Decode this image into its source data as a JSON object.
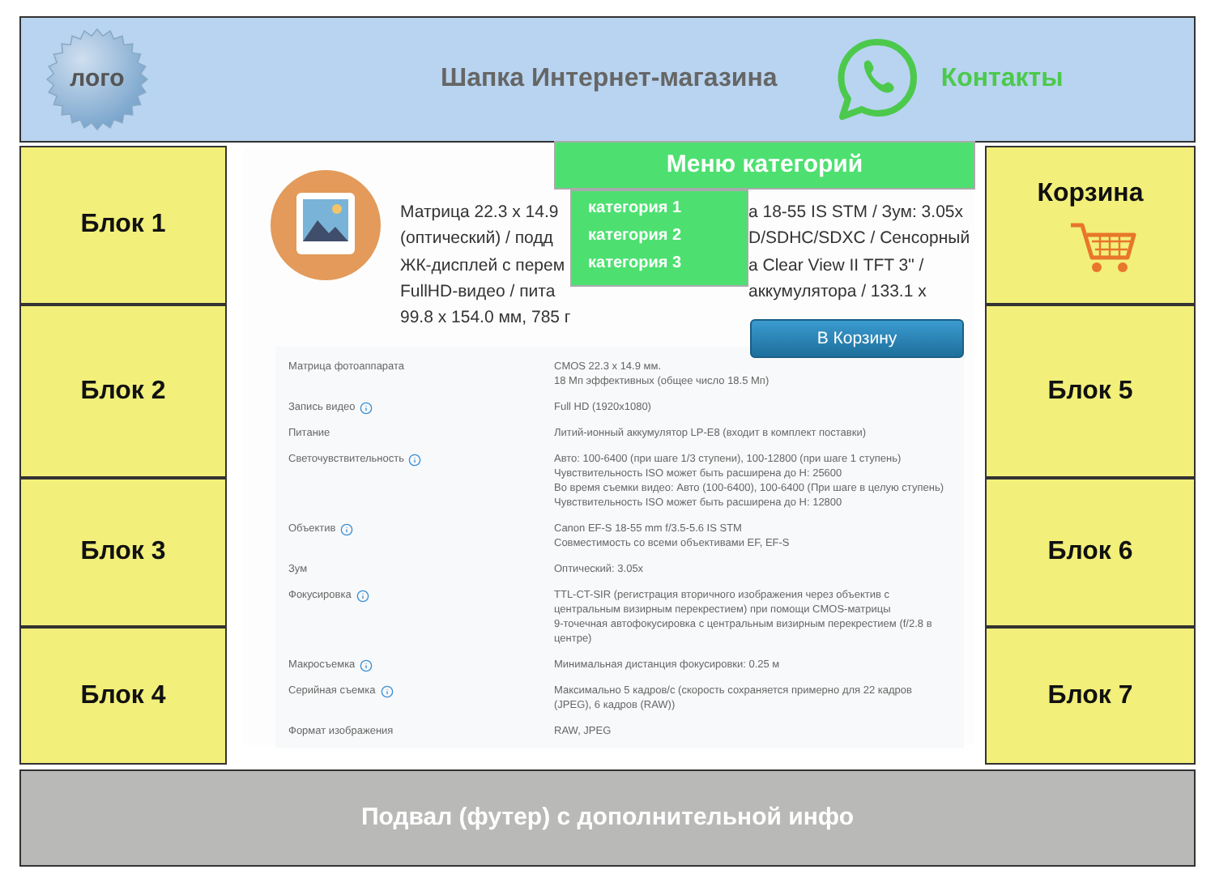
{
  "header": {
    "logo": "лого",
    "title": "Шапка Интернет-магазина",
    "contacts": "Контакты"
  },
  "left_blocks": [
    "Блок 1",
    "Блок 2",
    "Блок 3",
    "Блок 4"
  ],
  "right_blocks": [
    {
      "kind": "cart",
      "label": "Корзина"
    },
    {
      "kind": "plain",
      "label": "Блок 5"
    },
    {
      "kind": "plain",
      "label": "Блок 6"
    },
    {
      "kind": "plain",
      "label": "Блок 7"
    }
  ],
  "menu": {
    "title": "Меню категорий",
    "items": [
      "категория 1",
      "категория 2",
      "категория 3"
    ]
  },
  "product": {
    "description_left": [
      "Матрица 22.3 x 14.9",
      "(оптический) / подд",
      "ЖК-дисплей с перем",
      "FullHD-видео / пита",
      "99.8 x 154.0 мм, 785 г"
    ],
    "description_right": [
      "а 18-55 IS STM / Зум: 3.05x",
      "D/SDHC/SDXC / Сенсорный",
      "a Clear View II TFT 3\" /",
      "аккумулятора / 133.1 x"
    ],
    "button": "В Корзину",
    "specs": [
      {
        "name": "Матрица фотоаппарата",
        "info": false,
        "value": [
          "CMOS 22.3 x 14.9 мм.",
          "18 Мп эффективных (общее число 18.5 Мп)"
        ]
      },
      {
        "name": "Запись видео",
        "info": true,
        "value": [
          "Full HD (1920x1080)"
        ]
      },
      {
        "name": "Питание",
        "info": false,
        "value": [
          "Литий-ионный аккумулятор LP-E8 (входит в комплект поставки)"
        ]
      },
      {
        "name": "Светочувствительность",
        "info": true,
        "value": [
          "Авто: 100-6400 (при шаге 1/3 ступени), 100-12800 (при шаге 1 ступень)",
          "Чувствительность ISO может быть расширена до H: 25600",
          "Во время съемки видео: Авто (100-6400), 100-6400 (При шаге в целую ступень)",
          "Чувствительность ISO может быть расширена до H: 12800"
        ]
      },
      {
        "name": "Объектив",
        "info": true,
        "value": [
          "Canon EF-S 18-55 mm f/3.5-5.6 IS STM",
          "Совместимость со всеми объективами EF, EF-S"
        ]
      },
      {
        "name": "Зум",
        "info": false,
        "value": [
          "Оптический: 3.05x"
        ]
      },
      {
        "name": "Фокусировка",
        "info": true,
        "value": [
          "TTL-CT-SIR (регистрация вторичного изображения через объектив с центральным визирным перекрестием) при помощи CMOS-матрицы",
          "9-точечная автофокусировка с центральным визирным перекрестием (f/2.8 в центре)"
        ]
      },
      {
        "name": "Макросъемка",
        "info": true,
        "value": [
          "Минимальная дистанция фокусировки: 0.25 м"
        ]
      },
      {
        "name": "Серийная съемка",
        "info": true,
        "value": [
          "Максимально 5 кадров/с (скорость сохраняется примерно для 22 кадров (JPEG), 6 кадров (RAW))"
        ]
      },
      {
        "name": "Формат изображения",
        "info": false,
        "value": [
          "RAW, JPEG"
        ]
      }
    ]
  },
  "footer": "Подвал (футер) с дополнительной инфо"
}
